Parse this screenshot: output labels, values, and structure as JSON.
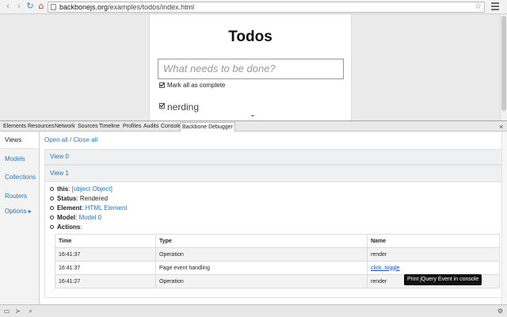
{
  "browser": {
    "url_host": "backbonejs.org",
    "url_path": "/examples/todos/index.html",
    "back_glyph": "‹",
    "forward_glyph": "›",
    "reload_glyph": "↻",
    "home_glyph": "⌂",
    "star_glyph": "☆"
  },
  "todo_page": {
    "title": "Todos",
    "input_placeholder": "What needs to be done?",
    "mark_all_label": "Mark all as complete",
    "item_label": "nerding",
    "next_item_hint": "\""
  },
  "devtools": {
    "tabs": [
      "Elements",
      "Resources",
      "Network",
      "Sources",
      "Timeline",
      "Profiles",
      "Audits",
      "Console",
      "Backbone Debugger"
    ],
    "active_tab": "Backbone Debugger",
    "close_glyph": "×"
  },
  "sidebar": {
    "items": [
      {
        "label": "Views"
      },
      {
        "label": "Models"
      },
      {
        "label": "Collections"
      },
      {
        "label": "Routers"
      },
      {
        "label": "Options ▸"
      }
    ],
    "active": "Views"
  },
  "main": {
    "open_all": "Open all",
    "separator": "/",
    "close_all": "Close all",
    "views": [
      {
        "label": "View 0"
      },
      {
        "label": "View 1"
      }
    ],
    "properties": {
      "this_label": "this",
      "this_value": "[object Object]",
      "status_label": "Status",
      "status_value": "Rendered",
      "element_label": "Element",
      "element_value": "HTML Element",
      "model_label": "Model",
      "model_value": "Model 0",
      "actions_label": "Actions"
    },
    "table": {
      "headers": [
        "Time",
        "Type",
        "Name"
      ],
      "rows": [
        {
          "time": "16:41:37",
          "type": "Operation",
          "name": "render"
        },
        {
          "time": "16:41:37",
          "type": "Page event handling",
          "name": "click .toggle"
        },
        {
          "time": "16:41:27",
          "type": "Operation",
          "name": "render"
        }
      ]
    },
    "tooltip": "Print jQuery Event in console"
  },
  "statusbar": {
    "icons": [
      "dock-icon",
      "console-drawer-icon",
      "search-icon",
      "gear-icon"
    ]
  },
  "colors": {
    "link": "#2a76b8",
    "tooltip_bg": "#111111"
  }
}
